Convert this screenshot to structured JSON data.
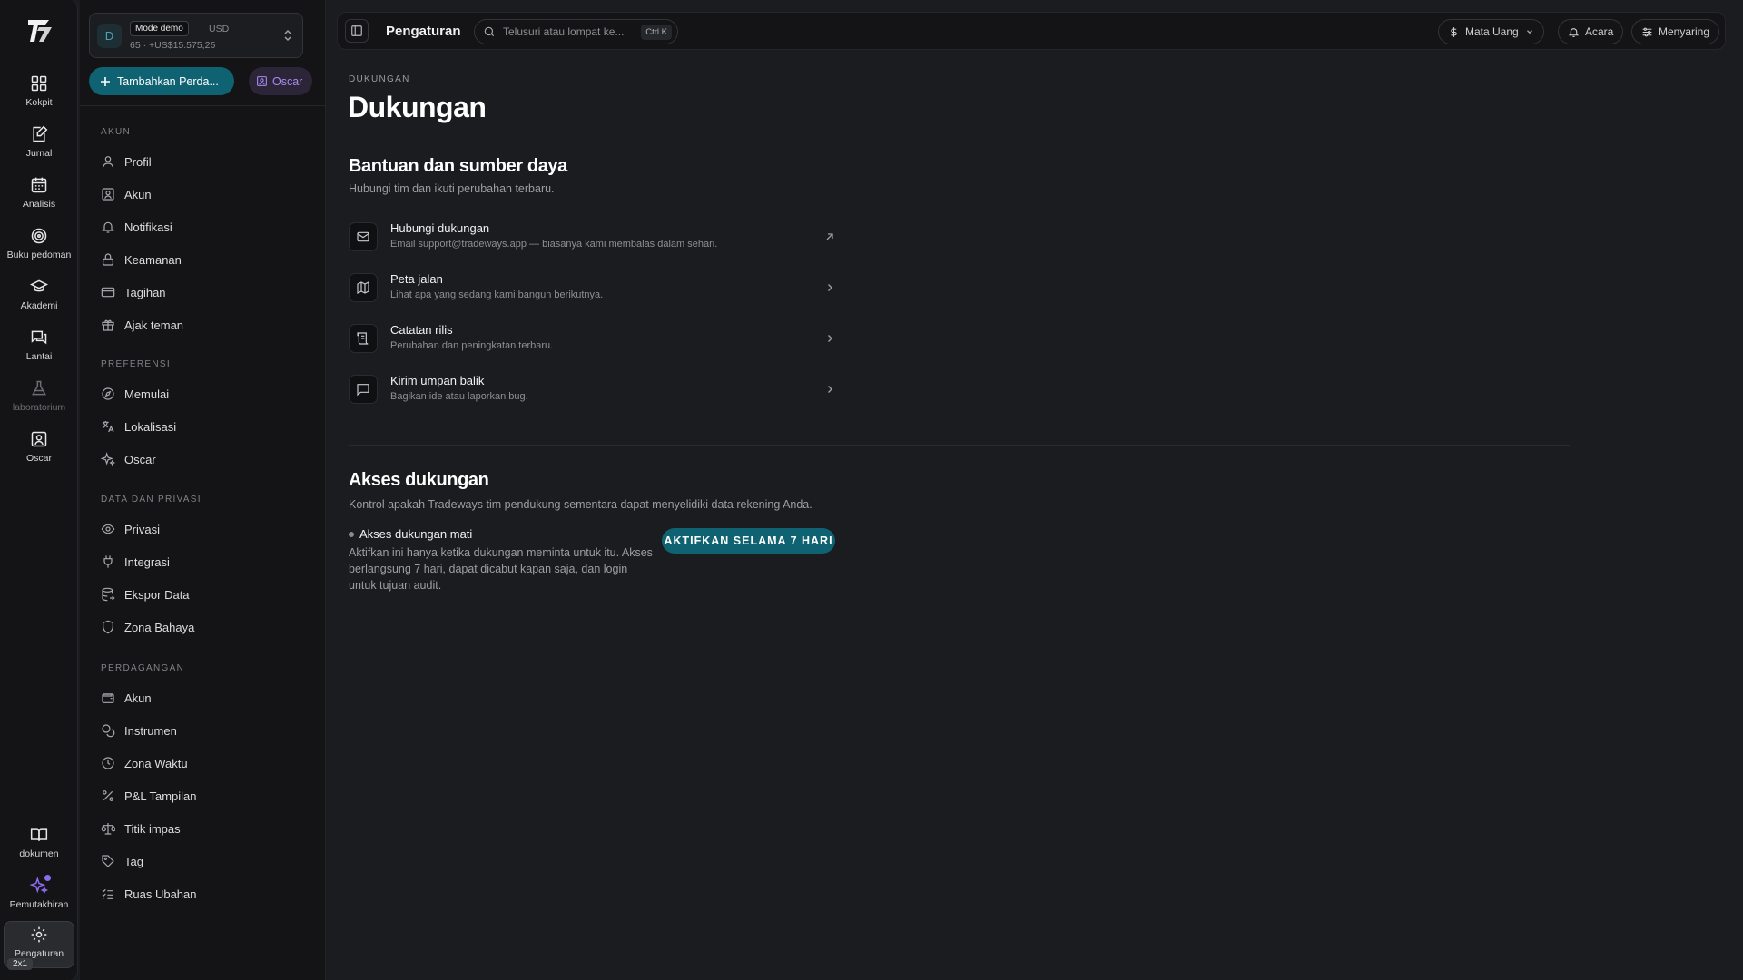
{
  "rail": {
    "items": [
      {
        "label": "Kokpit",
        "icon": "dashboard-icon"
      },
      {
        "label": "Jurnal",
        "icon": "journal-icon"
      },
      {
        "label": "Analisis",
        "icon": "calendar-icon"
      },
      {
        "label": "Buku pedoman",
        "icon": "target-icon"
      },
      {
        "label": "Akademi",
        "icon": "graduation-cap-icon"
      },
      {
        "label": "Lantai",
        "icon": "chat-icon"
      },
      {
        "label": "laboratorium",
        "icon": "flask-icon"
      },
      {
        "label": "Oscar",
        "icon": "user-square-icon"
      }
    ],
    "bottom": [
      {
        "label": "dokumen",
        "icon": "book-icon"
      },
      {
        "label": "Pemutakhiran",
        "icon": "sparkles-icon"
      },
      {
        "label": "Pengaturan",
        "icon": "gear-icon"
      }
    ],
    "badge": "2x1"
  },
  "account": {
    "avatar": "D",
    "mode": "Mode demo",
    "currency": "USD",
    "balance": "65 · +US$15.575,25"
  },
  "sidebar": {
    "add_button": "Tambahkan Perda...",
    "oscar_button": "Oscar",
    "sections": [
      {
        "title": "AKUN",
        "items": [
          "Profil",
          "Akun",
          "Notifikasi",
          "Keamanan",
          "Tagihan",
          "Ajak teman"
        ]
      },
      {
        "title": "PREFERENSI",
        "items": [
          "Memulai",
          "Lokalisasi",
          "Oscar"
        ]
      },
      {
        "title": "DATA DAN PRIVASI",
        "items": [
          "Privasi",
          "Integrasi",
          "Ekspor Data",
          "Zona Bahaya"
        ]
      },
      {
        "title": "PERDAGANGAN",
        "items": [
          "Akun",
          "Instrumen",
          "Zona Waktu",
          "P&L Tampilan",
          "Titik impas",
          "Tag",
          "Ruas Ubahan"
        ]
      }
    ]
  },
  "topbar": {
    "title": "Pengaturan",
    "search_placeholder": "Telusuri atau lompat ke...",
    "shortcut": "Ctrl K",
    "currency_btn": "Mata Uang",
    "events_btn": "Acara",
    "filter_btn": "Menyaring"
  },
  "main": {
    "breadcrumb": "DUKUNGAN",
    "title": "Dukungan",
    "help": {
      "title": "Bantuan dan sumber daya",
      "subtitle": "Hubungi tim dan ikuti perubahan terbaru.",
      "rows": [
        {
          "title": "Hubungi dukungan",
          "desc": "Email support@tradeways.app — biasanya kami membalas dalam sehari."
        },
        {
          "title": "Peta jalan",
          "desc": "Lihat apa yang sedang kami bangun berikutnya."
        },
        {
          "title": "Catatan rilis",
          "desc": "Perubahan dan peningkatan terbaru."
        },
        {
          "title": "Kirim umpan balik",
          "desc": "Bagikan ide atau laporkan bug."
        }
      ]
    },
    "access": {
      "title": "Akses dukungan",
      "subtitle": "Kontrol apakah Tradeways tim pendukung sementara dapat menyelidiki data rekening Anda.",
      "status": "Akses dukungan mati",
      "help_text": "Aktifkan ini hanya ketika dukungan meminta untuk itu. Akses berlangsung 7 hari, dapat dicabut kapan saja, dan login untuk tujuan audit.",
      "button": "AKTIFKAN SELAMA 7 HARI"
    }
  },
  "colors": {
    "accent": "#0f6272",
    "purple": "#8b6cf0",
    "background": "#1b1c1f",
    "sidebar": "#141416"
  }
}
